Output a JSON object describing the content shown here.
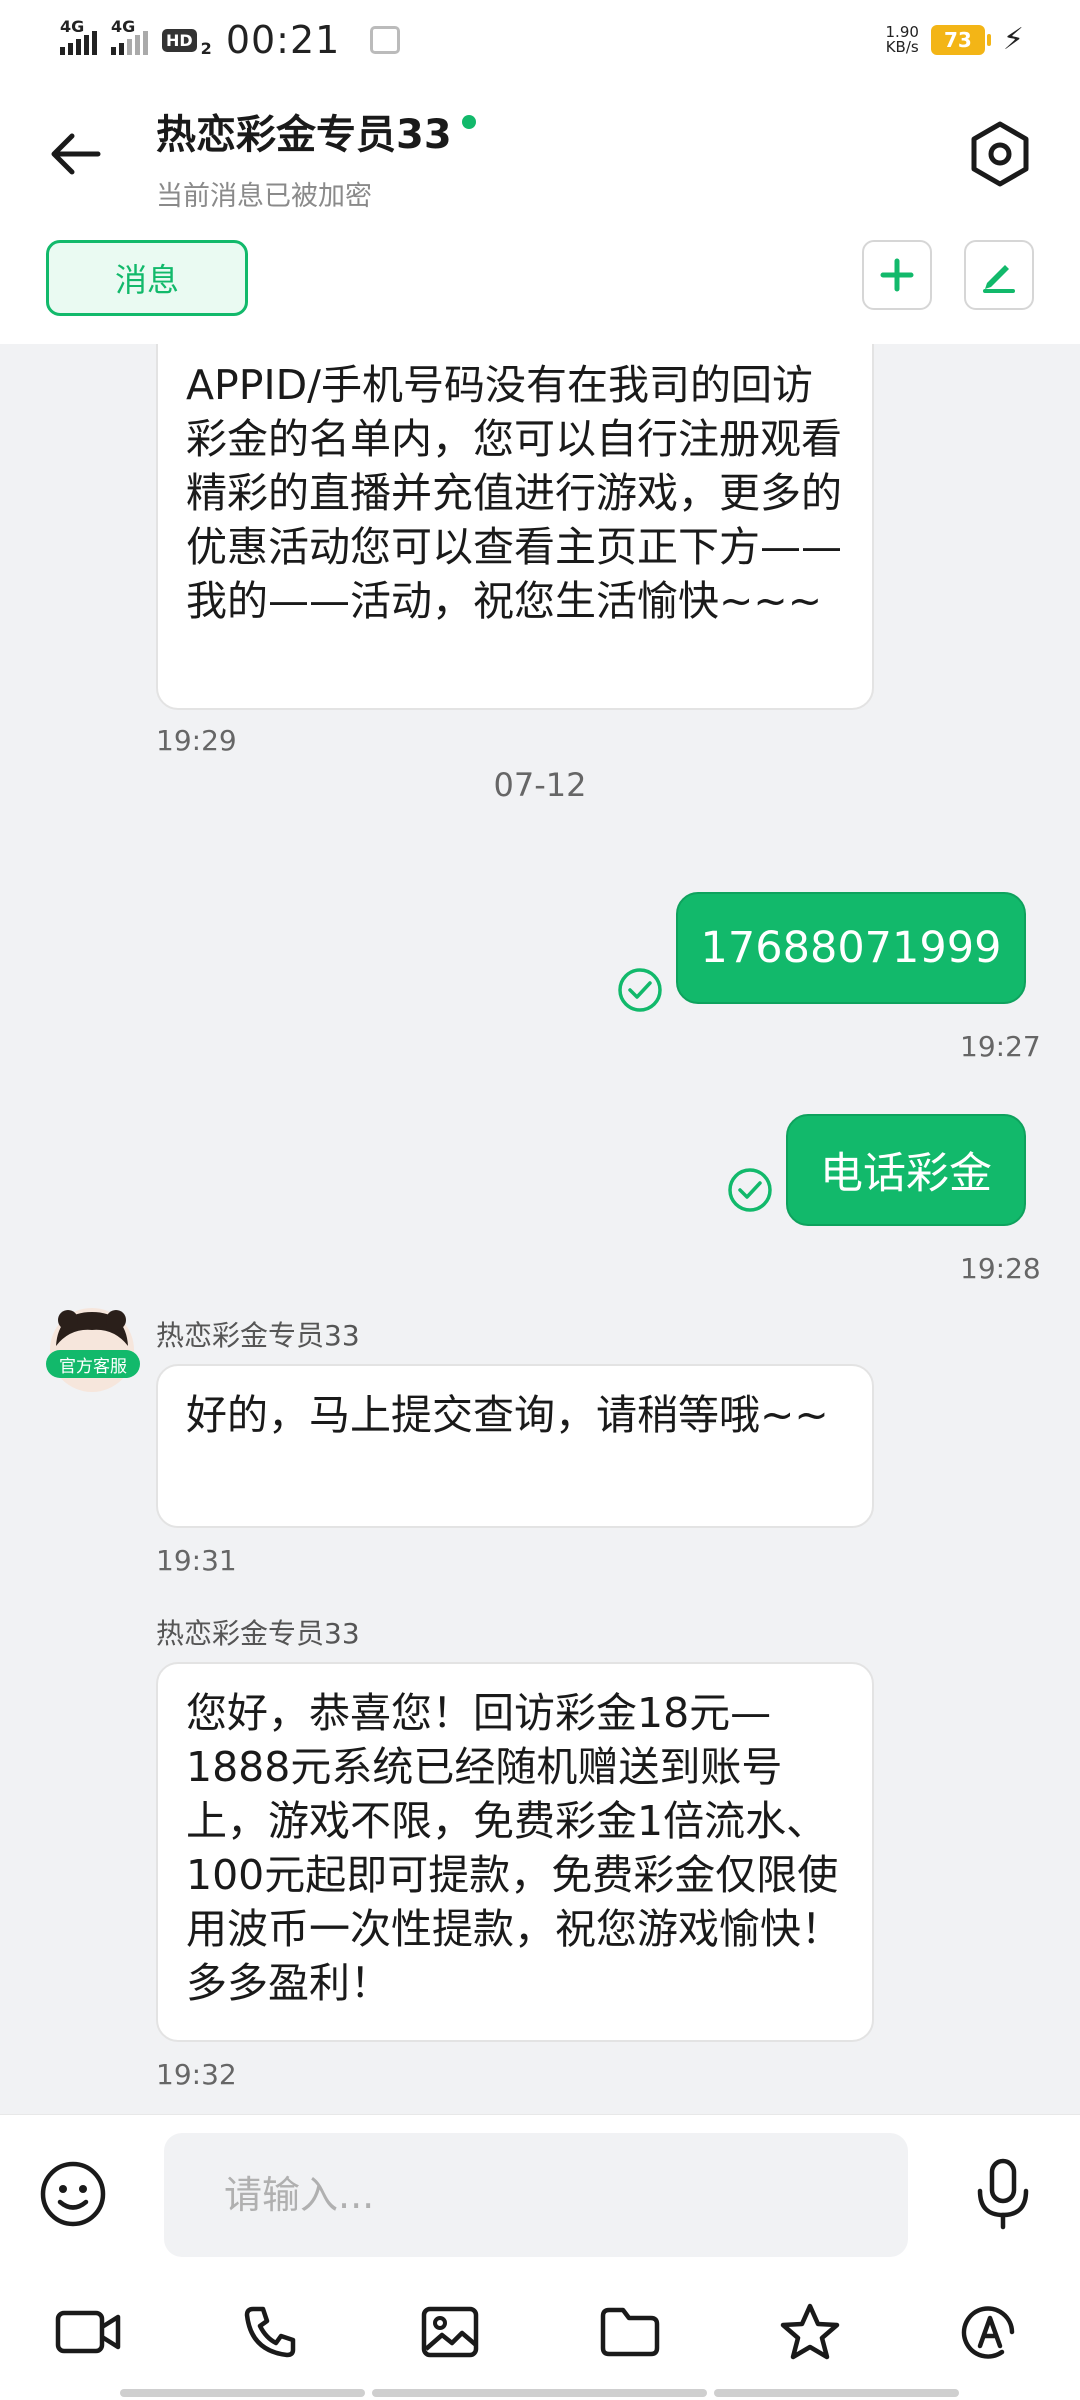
{
  "status_bar": {
    "net1": "4G",
    "net2": "4G",
    "hd": "HD",
    "hd_sub": "2",
    "time": "00:21",
    "speed_value": "1.90",
    "speed_unit": "KB/s",
    "battery": "73",
    "battery_color": "#f3b516"
  },
  "header": {
    "contact_name": "热恋彩金专员33",
    "subtitle": "当前消息已被加密",
    "tab_label": "消息"
  },
  "colors": {
    "accent": "#12b96b",
    "background": "#f1f2f4"
  },
  "messages": [
    {
      "direction": "in",
      "text": "APPID/手机号码没有在我司的回访彩金的名单内，您可以自行注册观看精彩的直播并充值进行游戏，更多的优惠活动您可以查看主页正下方——我的——活动，祝您生活愉快~~~",
      "time": "19:29"
    },
    {
      "type": "date",
      "text": "07-12"
    },
    {
      "direction": "out",
      "text": "17688071999",
      "time": "19:27",
      "status": "read-check-icon"
    },
    {
      "direction": "out",
      "text": "电话彩金",
      "time": "19:28",
      "status": "read-check-icon"
    },
    {
      "direction": "in",
      "sender": "热恋彩金专员33",
      "badge": "官方客服",
      "text": "好的，马上提交查询，请稍等哦~~",
      "time": "19:31"
    },
    {
      "direction": "in",
      "sender": "热恋彩金专员33",
      "text": "您好，恭喜您！回访彩金18元—1888元系统已经随机赠送到账号上，游戏不限，免费彩金1倍流水、100元起即可提款，免费彩金仅限使用波币一次性提款，祝您游戏愉快！多多盈利！",
      "time": "19:32"
    }
  ],
  "input": {
    "placeholder": "请输入..."
  },
  "toolbar": [
    "video-icon",
    "phone-icon",
    "image-icon",
    "folder-icon",
    "star-icon",
    "at-sign-icon"
  ]
}
